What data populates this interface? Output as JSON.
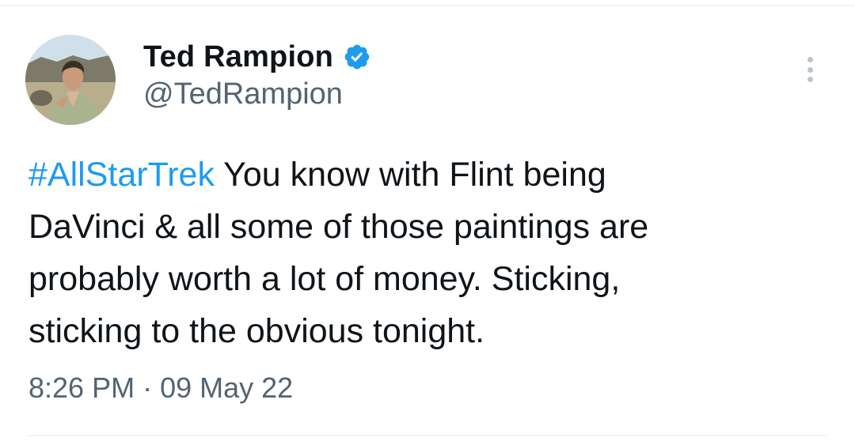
{
  "tweet": {
    "author": {
      "display_name": "Ted Rampion",
      "handle": "@TedRampion",
      "verified": true,
      "avatar_icon": "profile-photo"
    },
    "more_icon": "more-vertical-icon",
    "hashtag": "#AllStarTrek",
    "text_lines": [
      " You know with Flint being",
      "DaVinci & all some of those paintings are",
      "probably worth a lot of money. Sticking,",
      "sticking to the obvious tonight."
    ],
    "time": "8:26 PM",
    "separator": "·",
    "date": "09 May 22"
  },
  "colors": {
    "accent": "#1d9bf0",
    "text_primary": "#0f1419",
    "text_secondary": "#536471",
    "divider": "#eff3f4"
  }
}
